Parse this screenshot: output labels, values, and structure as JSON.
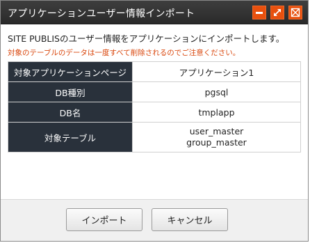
{
  "window": {
    "title": "アプリケーションユーザー情報インポート",
    "controls": [
      "minimize-icon",
      "maximize-icon",
      "close-icon"
    ],
    "accent_color": "#e8500e"
  },
  "message": {
    "lead": "SITE PUBLISのユーザー情報をアプリケーションにインポートします。",
    "warning": "対象のテーブルのデータは一度すべて削除されるのでご注意ください。",
    "warning_color": "#d9460c"
  },
  "table": {
    "rows": [
      {
        "label": "対象アプリケーションページ",
        "value": "アプリケーション1"
      },
      {
        "label": "DB種別",
        "value": "pgsql"
      },
      {
        "label": "DB名",
        "value": "tmplapp"
      },
      {
        "label": "対象テーブル",
        "values": [
          "user_master",
          "group_master"
        ]
      }
    ]
  },
  "buttons": {
    "import": "インポート",
    "cancel": "キャンセル"
  }
}
